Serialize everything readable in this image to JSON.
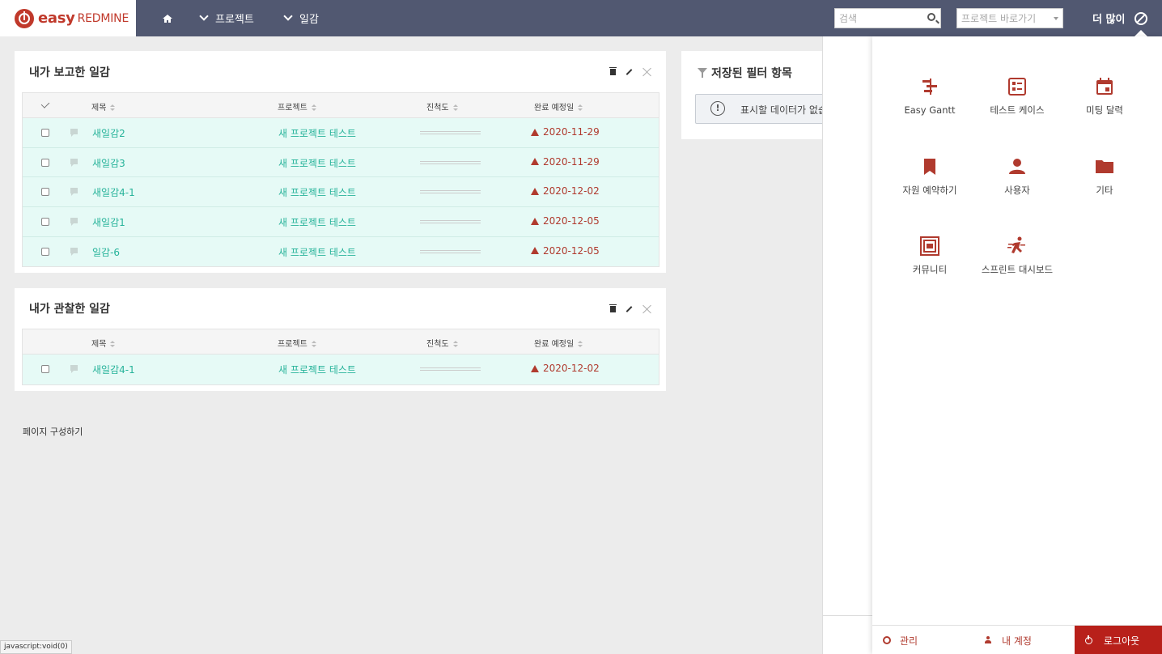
{
  "header": {
    "logo_easy": "easy",
    "logo_redmine": "REDMINE",
    "nav_projects": "프로젝트",
    "nav_logs": "일감",
    "search_placeholder": "검색",
    "project_jump_placeholder": "프로젝트 바로가기",
    "more_label": "더 많이"
  },
  "table_headers": {
    "subject": "제목",
    "project": "프로젝트",
    "progress": "진척도",
    "due_date": "완료 예정일"
  },
  "reported_panel": {
    "title": "내가 보고한 일감",
    "rows": [
      {
        "subject": "새일감2",
        "project": "새 프로젝트 테스트",
        "progress": 0,
        "due": "2020-11-29"
      },
      {
        "subject": "새일감3",
        "project": "새 프로젝트 테스트",
        "progress": 0,
        "due": "2020-11-29"
      },
      {
        "subject": "새일감4-1",
        "project": "새 프로젝트 테스트",
        "progress": 0,
        "due": "2020-12-02"
      },
      {
        "subject": "새일감1",
        "project": "새 프로젝트 테스트",
        "progress": 0,
        "due": "2020-12-05"
      },
      {
        "subject": "일감-6",
        "project": "새 프로젝트 테스트",
        "progress": 0,
        "due": "2020-12-05"
      }
    ]
  },
  "watched_panel": {
    "title": "내가 관찰한 일감",
    "rows": [
      {
        "subject": "새일감4-1",
        "project": "새 프로젝트 테스트",
        "progress": 0,
        "due": "2020-12-02"
      }
    ]
  },
  "filter_panel": {
    "title": "저장된 필터 항목",
    "no_data": "표시할 데이터가 없습니다."
  },
  "page_config_label": "페이지 구성하기",
  "more_menu": {
    "apps": [
      {
        "label": "Easy Gantt",
        "icon": "gantt-icon"
      },
      {
        "label": "테스트 케이스",
        "icon": "test-case-icon"
      },
      {
        "label": "미팅 달력",
        "icon": "calendar-icon"
      },
      {
        "label": "자원 예약하기",
        "icon": "bookmark-icon"
      },
      {
        "label": "사용자",
        "icon": "user-icon"
      },
      {
        "label": "기타",
        "icon": "folder-icon"
      },
      {
        "label": "커뮤니티",
        "icon": "community-icon"
      },
      {
        "label": "스프린트 대시보드",
        "icon": "sprint-icon"
      }
    ],
    "footer": {
      "admin": "관리",
      "my_account": "내 계정",
      "logout": "로그아웃"
    }
  },
  "status_bar": "javascript:void(0)",
  "colors": {
    "topbar": "#515871",
    "accent": "#b03a2e",
    "link": "#27b39a",
    "row_bg": "#e6faf6"
  }
}
